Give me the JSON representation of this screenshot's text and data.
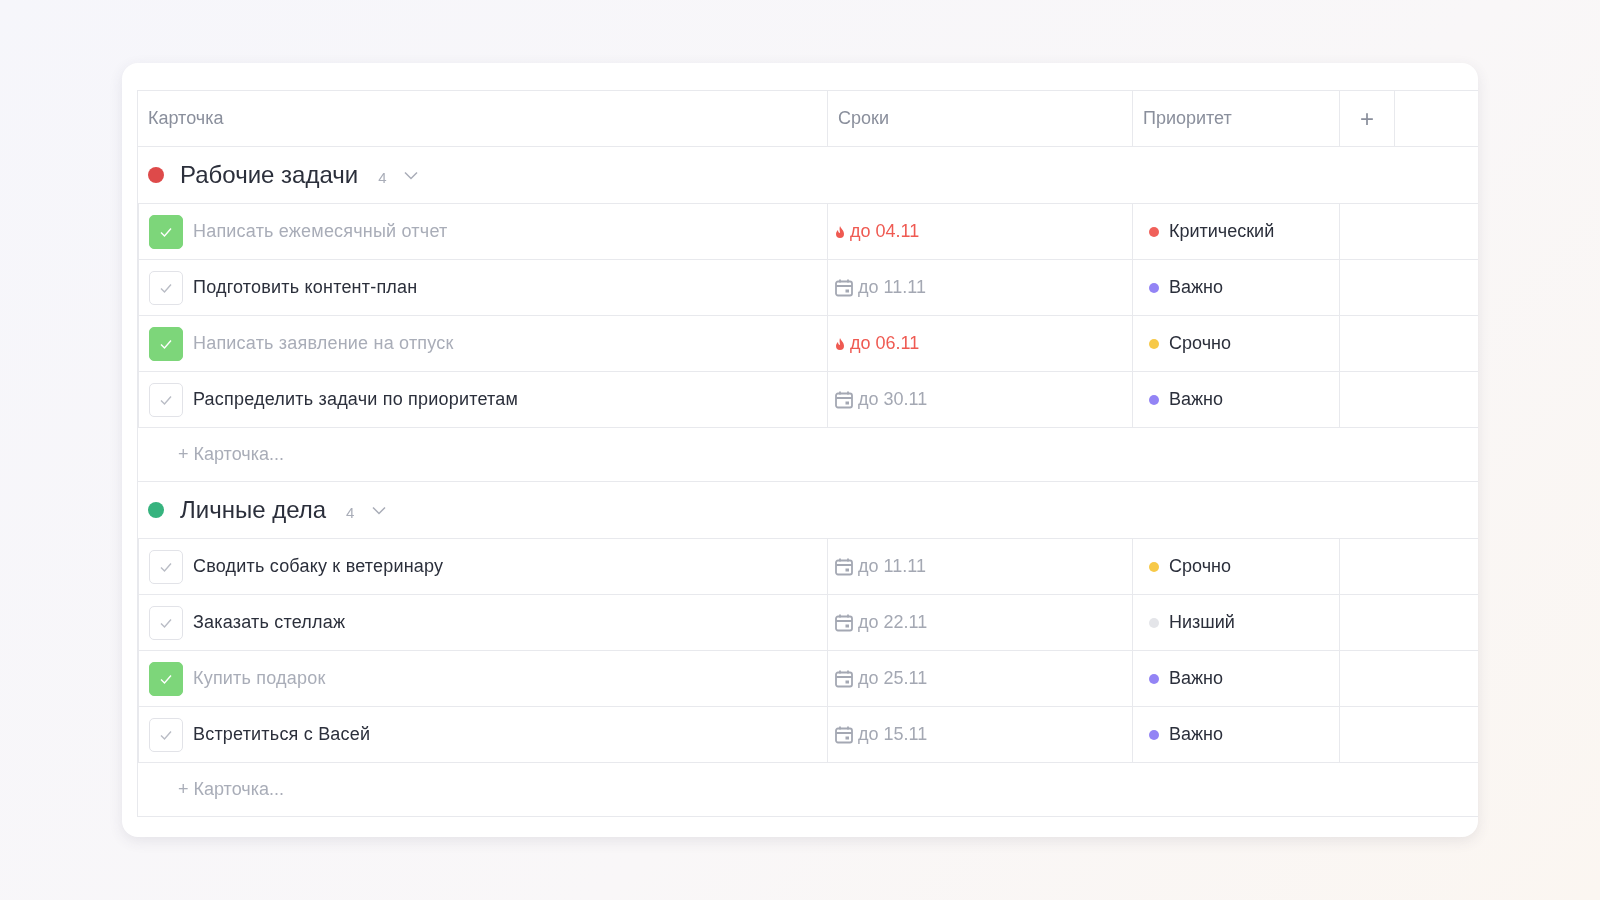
{
  "columns": [
    "Карточка",
    "Сроки",
    "Приоритет"
  ],
  "add_column": "+",
  "groups": [
    {
      "title": "Рабочие задачи",
      "count": "4",
      "color": "#de4a4a",
      "expanded": true,
      "tasks": [
        {
          "title": "Написать ежемесячный отчет",
          "checked": true,
          "due": {
            "kind": "overdue",
            "text": "до 04.11"
          },
          "priority": {
            "label": "Критический",
            "color": "#f0605a"
          }
        },
        {
          "title": "Подготовить контент-план",
          "checked": false,
          "due": {
            "kind": "planned",
            "text": "до 11.11"
          },
          "priority": {
            "label": "Важно",
            "color": "#9384f5"
          }
        },
        {
          "title": "Написать заявление на отпуск",
          "checked": true,
          "due": {
            "kind": "overdue",
            "text": "до 06.11"
          },
          "priority": {
            "label": "Срочно",
            "color": "#f7c948"
          }
        },
        {
          "title": "Распределить задачи по приоритетам",
          "checked": false,
          "due": {
            "kind": "planned",
            "text": "до 30.11"
          },
          "priority": {
            "label": "Важно",
            "color": "#9384f5"
          }
        }
      ],
      "add_label": "+ Карточка..."
    },
    {
      "title": "Личные дела",
      "count": "4",
      "color": "#36b37e",
      "expanded": true,
      "tasks": [
        {
          "title": "Сводить собаку к ветеринару",
          "checked": false,
          "due": {
            "kind": "planned",
            "text": "до 11.11"
          },
          "priority": {
            "label": "Срочно",
            "color": "#f7c948"
          }
        },
        {
          "title": "Заказать стеллаж",
          "checked": false,
          "due": {
            "kind": "planned",
            "text": "до 22.11"
          },
          "priority": {
            "label": "Низший",
            "color": "#e4e5e9"
          }
        },
        {
          "title": "Купить подарок",
          "checked": true,
          "due": {
            "kind": "planned",
            "text": "до 25.11"
          },
          "priority": {
            "label": "Важно",
            "color": "#9384f5"
          }
        },
        {
          "title": "Встретиться с Васей",
          "checked": false,
          "due": {
            "kind": "planned",
            "text": "до 15.11"
          },
          "priority": {
            "label": "Важно",
            "color": "#9384f5"
          }
        }
      ],
      "add_label": "+ Карточка..."
    }
  ]
}
